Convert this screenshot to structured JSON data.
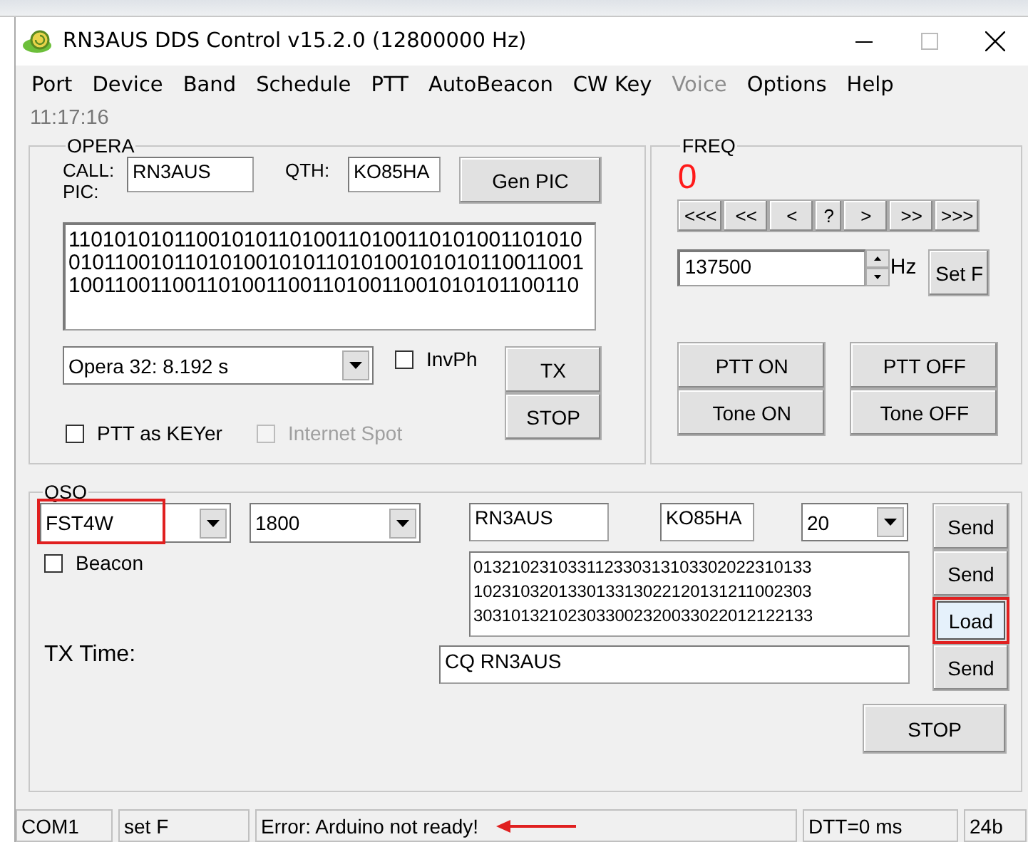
{
  "window": {
    "title": "RN3AUS DDS Control v15.2.0 (12800000 Hz)"
  },
  "menu": [
    {
      "label": "Port",
      "disabled": false
    },
    {
      "label": "Device",
      "disabled": false
    },
    {
      "label": "Band",
      "disabled": false
    },
    {
      "label": "Schedule",
      "disabled": false
    },
    {
      "label": "PTT",
      "disabled": false
    },
    {
      "label": "AutoBeacon",
      "disabled": false
    },
    {
      "label": "CW Key",
      "disabled": false
    },
    {
      "label": "Voice",
      "disabled": true
    },
    {
      "label": "Options",
      "disabled": false
    },
    {
      "label": "Help",
      "disabled": false
    }
  ],
  "clock": "11:17:16",
  "opera": {
    "title": "OPERA",
    "call_label": "CALL:",
    "call": "RN3AUS",
    "qth_label": "QTH:",
    "qth": "KO85HA",
    "gen_button": "Gen PIC",
    "pic_label": "PIC:",
    "pic": [
      "11010101011001010110100110100110101001101010",
      "01011001011010100101011010100101010110011001",
      "10011001100110100110011010011001010101100110"
    ],
    "mode": "Opera 32: 8.192 s",
    "checkboxes": [
      {
        "label": "InvPh",
        "checked": false,
        "disabled": false
      },
      {
        "label": "PTT as KEYer",
        "checked": false,
        "disabled": false
      },
      {
        "label": "Internet Spot",
        "checked": false,
        "disabled": true
      }
    ],
    "buttons": [
      "TX",
      "STOP"
    ]
  },
  "freq": {
    "title": "FREQ",
    "readout": "0",
    "steps": [
      "<<<",
      "<<",
      "<",
      "?",
      ">",
      ">>",
      ">>>"
    ],
    "value": "137500",
    "unit": "Hz",
    "set_button": "Set F",
    "buttons": [
      "PTT ON",
      "PTT OFF",
      "Tone ON",
      "Tone OFF"
    ]
  },
  "qso": {
    "title": "QSO",
    "mode": {
      "value": "FST4W",
      "highlighted": true
    },
    "band": "1800",
    "call": "RN3AUS",
    "locator": "KO85HA",
    "power": "20",
    "beacon": {
      "label": "Beacon",
      "checked": false
    },
    "symbols": [
      "013210231033112330313103302022310133",
      "102310320133013313022120131211002303",
      "303101321023033002320033022012122133"
    ],
    "tx_time_label": "TX Time:",
    "message": "CQ RN3AUS",
    "buttons": [
      {
        "label": "Send",
        "highlighted": false
      },
      {
        "label": "Send",
        "highlighted": false
      },
      {
        "label": "Load",
        "highlighted": true
      },
      {
        "label": "Send",
        "highlighted": false
      }
    ],
    "stop_button": "STOP"
  },
  "status_bar": [
    {
      "text": "COM1",
      "pointer": false
    },
    {
      "text": "set F",
      "pointer": false
    },
    {
      "text": "Error: Arduino not ready!",
      "pointer": true
    },
    {
      "text": "DTT=0 ms",
      "pointer": false
    },
    {
      "text": "24b",
      "pointer": false
    }
  ]
}
